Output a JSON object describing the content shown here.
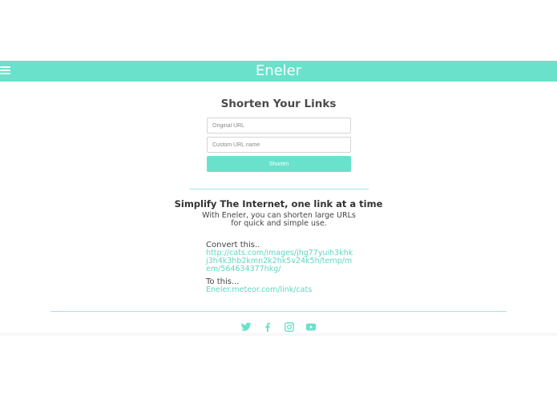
{
  "navbar": {
    "brand": "Eneler",
    "menu_icon": "hamburger-icon",
    "background": "#6ae1cb"
  },
  "form": {
    "title": "Shorten Your Links",
    "original_url": {
      "placeholder": "Original URL",
      "value": ""
    },
    "custom_name": {
      "placeholder": "Custom URL name",
      "value": ""
    },
    "submit_label": "Shorten"
  },
  "info": {
    "tagline": "Simplify The Internet, one link at a time",
    "description": "With Eneler, you can shorten large URLs for quick and simple use.",
    "before_label": "Convert this..",
    "before_link": "http://cats.com/images/jhg77yuih3khkj3h4k3hb2kmn2k2hk5v24k5h/temp/mem/564634377hkg/",
    "after_label": "To this...",
    "after_link": "Eneler.meteor.com/link/cats"
  },
  "social": [
    {
      "name": "twitter",
      "icon": "twitter-icon"
    },
    {
      "name": "facebook",
      "icon": "facebook-icon"
    },
    {
      "name": "instagram",
      "icon": "instagram-icon"
    },
    {
      "name": "youtube",
      "icon": "youtube-icon"
    }
  ],
  "colors": {
    "accent": "#6ae1cb",
    "link": "#5fd6c1",
    "text": "#444444"
  }
}
